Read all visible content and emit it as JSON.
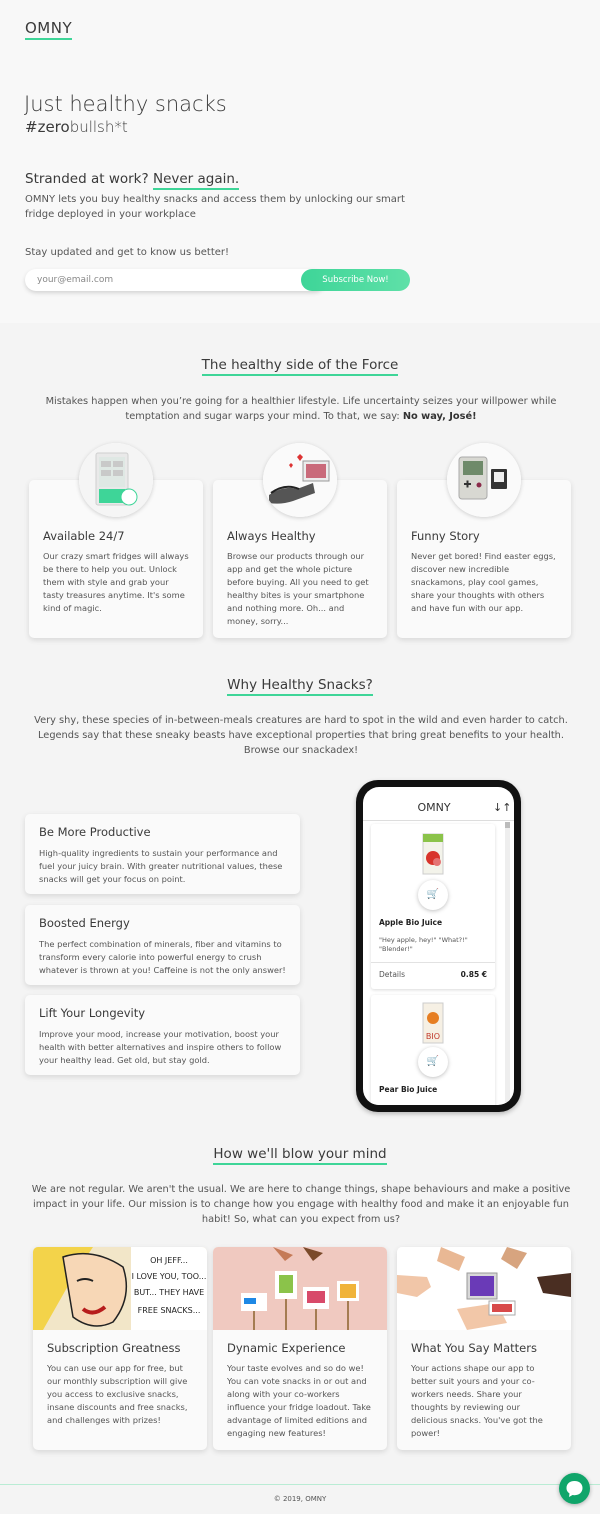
{
  "header": {
    "logo": "OMNY"
  },
  "hero": {
    "title": "Just healthy snacks",
    "subtitle_prefix": "#zero",
    "subtitle_rest": "bullsh*t",
    "stranded_prefix": "Stranded at work?",
    "stranded_link": "Never again.",
    "intro": "OMNY lets you buy healthy snacks and access them by unlocking our smart fridge deployed in your workplace",
    "stay_updated": "Stay updated and get to know us better!",
    "email_placeholder": "your@email.com",
    "subscribe_label": "Subscribe Now!"
  },
  "force": {
    "title": "The healthy side of the Force",
    "text_a": "Mistakes happen when you’re going for a healthier lifestyle. Life uncertainty seizes your willpower while temptation and sugar warps your mind. To that, we say:",
    "text_bold": "No way, José!",
    "cards": [
      {
        "title": "Available 24/7",
        "text": "Our crazy smart fridges will always be there to help you out. Unlock them with style and grab your tasty treasures anytime. It's some kind of magic."
      },
      {
        "title": "Always Healthy",
        "text": "Browse our products through our app and get the whole picture before buying. All you need to get healthy bites is your smartphone and nothing more. Oh... and money, sorry..."
      },
      {
        "title": "Funny Story",
        "text": "Never get bored! Find easter eggs, discover new incredible snackamons, play cool games, share your thoughts with others and have fun with our app."
      }
    ]
  },
  "why": {
    "title": "Why Healthy Snacks?",
    "text": "Very shy, these species of in-between-meals creatures are hard to spot in the wild and even harder to catch. Legends say that these sneaky beasts have exceptional properties that bring great benefits to your health. Browse our snackadex!",
    "benefits": [
      {
        "title": "Be More Productive",
        "text": "High-quality ingredients to sustain your performance and fuel your juicy brain. With greater nutritional values, these snacks will get your focus on point."
      },
      {
        "title": "Boosted Energy",
        "text": "The perfect combination of minerals, fiber and vitamins to transform every calorie into powerful energy to crush whatever is thrown at you! Caffeine is not the only answer!"
      },
      {
        "title": "Lift Your Longevity",
        "text": "Improve your mood, increase your motivation, boost your health with better alternatives and inspire others to follow your healthy lead. Get old, but stay gold."
      }
    ],
    "phone": {
      "logo": "OMNY",
      "sort_icon": "↓↑",
      "products": [
        {
          "name": "Apple Bio Juice",
          "desc": "\"Hey apple, hey!\" \"What?!\" \"Blender!\"",
          "details": "Details",
          "price": "0.85 €"
        },
        {
          "name": "Pear Bio Juice",
          "bio_label": "BIO"
        }
      ]
    }
  },
  "mind": {
    "title": "How we'll blow your mind",
    "text": "We are not regular. We aren't the usual. We are here to change things, shape behaviours and make a positive impact in your life. Our mission is to change how you engage with healthy food and make it an enjoyable fun habit! So, what can you expect from us?",
    "comic_text": [
      "OH JEFF...",
      "I LOVE YOU, TOO...",
      "BUT... THEY HAVE",
      "FREE SNACKS..."
    ],
    "cards": [
      {
        "title": "Subscription Greatness",
        "text": "You can use our app for free, but our monthly subscription will give you access to exclusive snacks, insane discounts and free snacks, and challenges with prizes!"
      },
      {
        "title": "Dynamic Experience",
        "text": "Your taste evolves and so do we! You can vote snacks in or out and along with your co-workers influence your fridge loadout. Take advantage of limited editions and engaging new features!"
      },
      {
        "title": "What You Say Matters",
        "text": "Your actions shape our app to better suit yours and your co-workers needs. Share your thoughts by reviewing our delicious snacks. You've got the power!"
      }
    ]
  },
  "footer": {
    "copyright": "© 2019, OMNY"
  },
  "colors": {
    "accent": "#3ed598",
    "chat": "#10a56a"
  }
}
